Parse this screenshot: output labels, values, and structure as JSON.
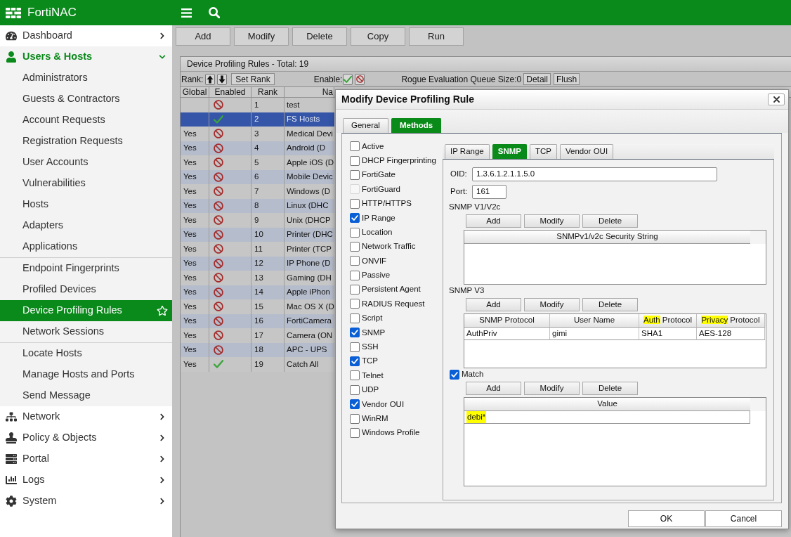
{
  "app": {
    "title": "FortiNAC"
  },
  "sidebar": {
    "items": [
      {
        "label": "Dashboard",
        "expanded": false
      },
      {
        "label": "Users & Hosts",
        "expanded": true,
        "groups": [
          {
            "items": [
              {
                "label": "Administrators",
                "selected": false
              },
              {
                "label": "Guests & Contractors",
                "selected": false
              },
              {
                "label": "Account Requests",
                "selected": false
              },
              {
                "label": "Registration Requests",
                "selected": false
              },
              {
                "label": "User Accounts",
                "selected": false
              },
              {
                "label": "Vulnerabilities",
                "selected": false
              },
              {
                "label": "Hosts",
                "selected": false
              },
              {
                "label": "Adapters",
                "selected": false
              },
              {
                "label": "Applications",
                "selected": false
              }
            ]
          },
          {
            "items": [
              {
                "label": "Endpoint Fingerprints",
                "selected": false
              },
              {
                "label": "Profiled Devices",
                "selected": false
              },
              {
                "label": "Device Profiling Rules",
                "selected": true
              },
              {
                "label": "Network Sessions",
                "selected": false
              }
            ]
          },
          {
            "items": [
              {
                "label": "Locate Hosts",
                "selected": false
              },
              {
                "label": "Manage Hosts and Ports",
                "selected": false
              },
              {
                "label": "Send Message",
                "selected": false
              }
            ]
          }
        ]
      },
      {
        "label": "Network",
        "expanded": false
      },
      {
        "label": "Policy & Objects",
        "expanded": false
      },
      {
        "label": "Portal",
        "expanded": false
      },
      {
        "label": "Logs",
        "expanded": false
      },
      {
        "label": "System",
        "expanded": false
      }
    ]
  },
  "toolbar": {
    "buttons": [
      "Add",
      "Modify",
      "Delete",
      "Copy",
      "Run"
    ]
  },
  "rules_panel": {
    "title": "Device Profiling Rules - Total: 19",
    "rank_label": "Rank:",
    "set_rank_button": "Set Rank",
    "enable_label": "Enable:",
    "queue_label": "Rogue Evaluation Queue Size:0",
    "buttons": [
      "Detail",
      "Flush"
    ],
    "table": {
      "columns": [
        "Global",
        "Enabled",
        "Rank",
        "Na"
      ],
      "rows": [
        {
          "enabled": false,
          "rank": "1",
          "name": "test",
          "selected": false
        },
        {
          "enabled": true,
          "rank": "2",
          "name": "FS Hosts",
          "selected": true
        },
        {
          "global": "Yes",
          "enabled": false,
          "rank": "3",
          "name": "Medical Devi",
          "selected": false
        },
        {
          "global": "Yes",
          "enabled": false,
          "rank": "4",
          "name": "Android (D",
          "selected": false
        },
        {
          "global": "Yes",
          "enabled": false,
          "rank": "5",
          "name": "Apple iOS (D",
          "selected": false
        },
        {
          "global": "Yes",
          "enabled": false,
          "rank": "6",
          "name": "Mobile Devic",
          "selected": false
        },
        {
          "global": "Yes",
          "enabled": false,
          "rank": "7",
          "name": "Windows (D",
          "selected": false
        },
        {
          "global": "Yes",
          "enabled": false,
          "rank": "8",
          "name": "Linux (DHC",
          "selected": false
        },
        {
          "global": "Yes",
          "enabled": false,
          "rank": "9",
          "name": "Unix (DHCP",
          "selected": false
        },
        {
          "global": "Yes",
          "enabled": false,
          "rank": "10",
          "name": "Printer (DHC",
          "selected": false
        },
        {
          "global": "Yes",
          "enabled": false,
          "rank": "11",
          "name": "Printer (TCP",
          "selected": false
        },
        {
          "global": "Yes",
          "enabled": false,
          "rank": "12",
          "name": "IP Phone (D",
          "selected": false
        },
        {
          "global": "Yes",
          "enabled": false,
          "rank": "13",
          "name": "Gaming (DH",
          "selected": false
        },
        {
          "global": "Yes",
          "enabled": false,
          "rank": "14",
          "name": "Apple iPhon",
          "selected": false
        },
        {
          "global": "Yes",
          "enabled": false,
          "rank": "15",
          "name": "Mac OS X (D",
          "selected": false
        },
        {
          "global": "Yes",
          "enabled": false,
          "rank": "16",
          "name": "FortiCamera",
          "selected": false
        },
        {
          "global": "Yes",
          "enabled": false,
          "rank": "17",
          "name": "Camera (ON",
          "selected": false
        },
        {
          "global": "Yes",
          "enabled": false,
          "rank": "18",
          "name": "APC - UPS",
          "selected": false
        },
        {
          "global": "Yes",
          "enabled": true,
          "rank": "19",
          "name": "Catch All",
          "selected": false
        }
      ]
    }
  },
  "dialog": {
    "title": "Modify Device Profiling Rule",
    "tabs": [
      {
        "label": "General",
        "selected": false
      },
      {
        "label": "Methods",
        "selected": true
      }
    ],
    "methods": [
      {
        "label": "Active",
        "checked": false,
        "disabled": false
      },
      {
        "label": "DHCP Fingerprinting",
        "checked": false,
        "disabled": false
      },
      {
        "label": "FortiGate",
        "checked": false,
        "disabled": false
      },
      {
        "label": "FortiGuard",
        "checked": false,
        "disabled": true
      },
      {
        "label": "HTTP/HTTPS",
        "checked": false,
        "disabled": false
      },
      {
        "label": "IP Range",
        "checked": true,
        "disabled": false
      },
      {
        "label": "Location",
        "checked": false,
        "disabled": false
      },
      {
        "label": "Network Traffic",
        "checked": false,
        "disabled": false
      },
      {
        "label": "ONVIF",
        "checked": false,
        "disabled": false
      },
      {
        "label": "Passive",
        "checked": false,
        "disabled": false
      },
      {
        "label": "Persistent Agent",
        "checked": false,
        "disabled": false
      },
      {
        "label": "RADIUS Request",
        "checked": false,
        "disabled": false
      },
      {
        "label": "Script",
        "checked": false,
        "disabled": false
      },
      {
        "label": "SNMP",
        "checked": true,
        "disabled": false
      },
      {
        "label": "SSH",
        "checked": false,
        "disabled": false
      },
      {
        "label": "TCP",
        "checked": true,
        "disabled": false
      },
      {
        "label": "Telnet",
        "checked": false,
        "disabled": false
      },
      {
        "label": "UDP",
        "checked": false,
        "disabled": false
      },
      {
        "label": "Vendor OUI",
        "checked": true,
        "disabled": false
      },
      {
        "label": "WinRM",
        "checked": false,
        "disabled": false
      },
      {
        "label": "Windows Profile",
        "checked": false,
        "disabled": false
      }
    ],
    "method_tabs": [
      {
        "label": "IP Range",
        "selected": false
      },
      {
        "label": "SNMP",
        "selected": true
      },
      {
        "label": "TCP",
        "selected": false
      },
      {
        "label": "Vendor OUI",
        "selected": false
      }
    ],
    "snmp": {
      "oid": {
        "label": "OID:",
        "value": "1.3.6.1.2.1.1.5.0"
      },
      "port": {
        "label": "Port:",
        "value": "161"
      },
      "sections": [
        {
          "kind": "heading",
          "title": "SNMP V1/V2c",
          "buttons": [
            "Add",
            "Modify",
            "Delete"
          ],
          "table": {
            "columns": [
              {
                "parts": [
                  {
                    "text": "SNMPv1/v2c Security String",
                    "highlighted": false
                  }
                ]
              }
            ]
          }
        },
        {
          "kind": "heading",
          "title": "SNMP V3",
          "buttons": [
            "Add",
            "Modify",
            "Delete"
          ],
          "table": {
            "columns": [
              {
                "parts": [
                  {
                    "text": "SNMP Protocol",
                    "highlighted": false
                  }
                ]
              },
              {
                "parts": [
                  {
                    "text": "User Name",
                    "highlighted": false
                  }
                ]
              },
              {
                "parts": [
                  {
                    "text": "Auth",
                    "highlighted": true
                  },
                  {
                    "text": "Protocol",
                    "highlighted": false
                  }
                ]
              },
              {
                "parts": [
                  {
                    "text": "Privacy",
                    "highlighted": true
                  },
                  {
                    "text": "Protocol",
                    "highlighted": false
                  }
                ]
              }
            ],
            "rows": [
              {
                "cells": [
                  {
                    "text": "AuthPriv",
                    "highlighted": false
                  },
                  {
                    "text": "gimi",
                    "highlighted": false
                  },
                  {
                    "text": "SHA1",
                    "highlighted": false
                  },
                  {
                    "text": "AES-128",
                    "highlighted": false
                  }
                ]
              }
            ]
          }
        },
        {
          "kind": "checkbox",
          "title": "Match",
          "checked": true,
          "buttons": [
            "Add",
            "Modify",
            "Delete"
          ],
          "table": {
            "columns": [
              {
                "parts": [
                  {
                    "text": "Value",
                    "highlighted": false
                  }
                ]
              }
            ],
            "rows": [
              {
                "cells": [
                  {
                    "text": "debi*",
                    "highlighted": true
                  }
                ]
              }
            ]
          }
        }
      ]
    },
    "footer_buttons": [
      "OK",
      "Cancel"
    ]
  }
}
